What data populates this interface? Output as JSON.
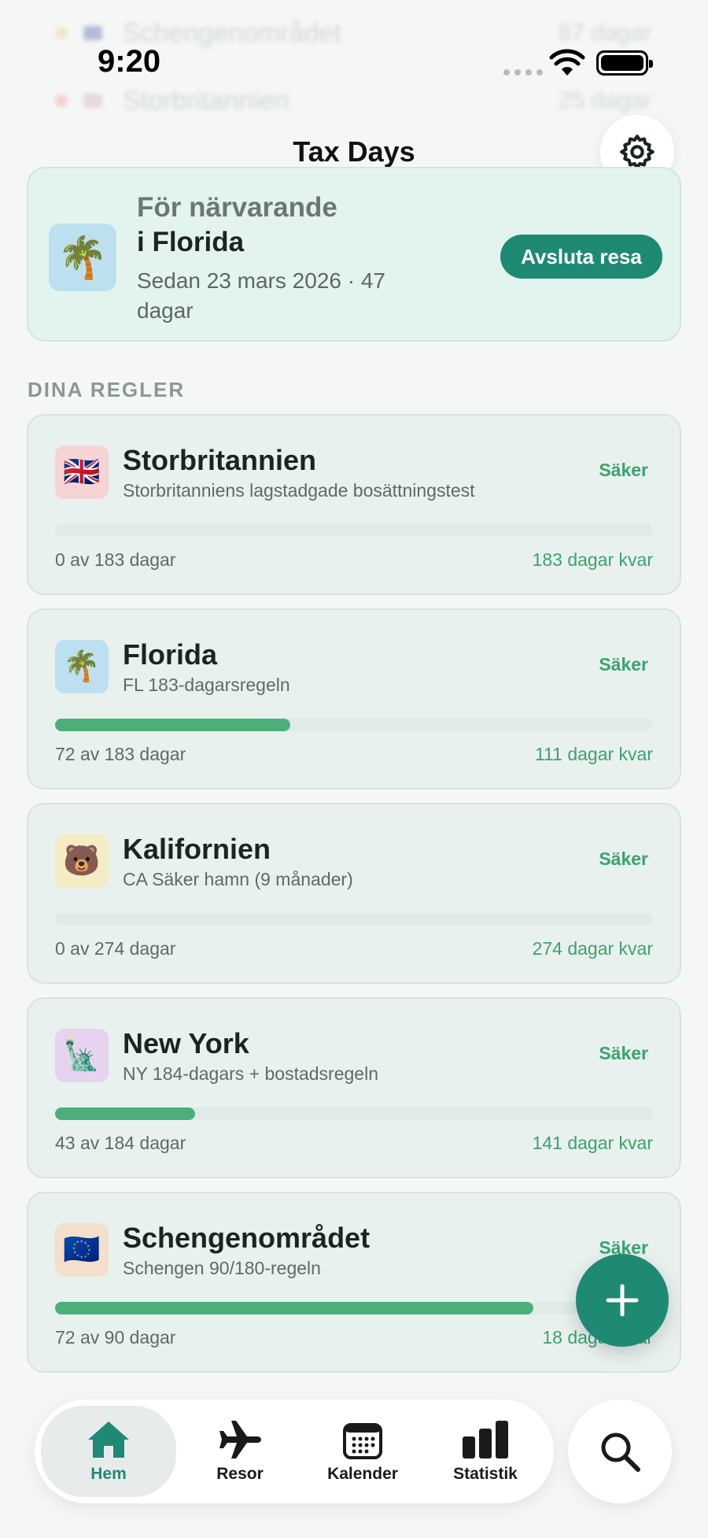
{
  "status_bar": {
    "time": "9:20"
  },
  "header": {
    "title": "Tax Days"
  },
  "ghost_rows": [
    {
      "label": "Schengenområdet",
      "value": "67 dagar",
      "color": "#f2c47a"
    },
    {
      "label": "Storbritannien",
      "value": "25 dagar",
      "color": "#f08a8a"
    }
  ],
  "current": {
    "line1": "För närvarande",
    "line2": "i Florida",
    "since": "Sedan 23 mars 2026 · 47 dagar",
    "icon": "🌴",
    "end_button": "Avsluta resa"
  },
  "section_title": "DINA REGLER",
  "rules": [
    {
      "name": "Storbritannien",
      "desc": "Storbritanniens lagstadgade bosättningstest",
      "status": "Säker",
      "used": "0 av 183 dagar",
      "left": "183 dagar kvar",
      "icon": "🇬🇧",
      "icon_bg": "#f6d4d6",
      "progress": 0
    },
    {
      "name": "Florida",
      "desc": "FL 183-dagarsregeln",
      "status": "Säker",
      "used": "72 av 183 dagar",
      "left": "111 dagar kvar",
      "icon": "🌴",
      "icon_bg": "#bde0f0",
      "progress": 0.393
    },
    {
      "name": "Kalifornien",
      "desc": "CA Säker hamn (9 månader)",
      "status": "Säker",
      "used": "0 av 274 dagar",
      "left": "274 dagar kvar",
      "icon": "🐻",
      "icon_bg": "#f4ecc4",
      "progress": 0
    },
    {
      "name": "New York",
      "desc": "NY 184-dagars + bostadsregeln",
      "status": "Säker",
      "used": "43 av 184 dagar",
      "left": "141 dagar kvar",
      "icon": "🗽",
      "icon_bg": "#e6d3ee",
      "progress": 0.234
    },
    {
      "name": "Schengenområdet",
      "desc": "Schengen 90/180-regeln",
      "status": "Säker",
      "used": "72 av 90 dagar",
      "left": "18 dagar kvar",
      "icon": "🇪🇺",
      "icon_bg": "#f3dfcc",
      "progress": 0.8
    }
  ],
  "tabs": [
    {
      "label": "Hem",
      "icon": "house-icon",
      "active": true
    },
    {
      "label": "Resor",
      "icon": "airplane-icon",
      "active": false
    },
    {
      "label": "Kalender",
      "icon": "calendar-icon",
      "active": false
    },
    {
      "label": "Statistik",
      "icon": "chart-bar-icon",
      "active": false
    }
  ],
  "colors": {
    "accent": "#1f8a73",
    "safe": "#3aa36f",
    "progress": "#4caf7a"
  }
}
